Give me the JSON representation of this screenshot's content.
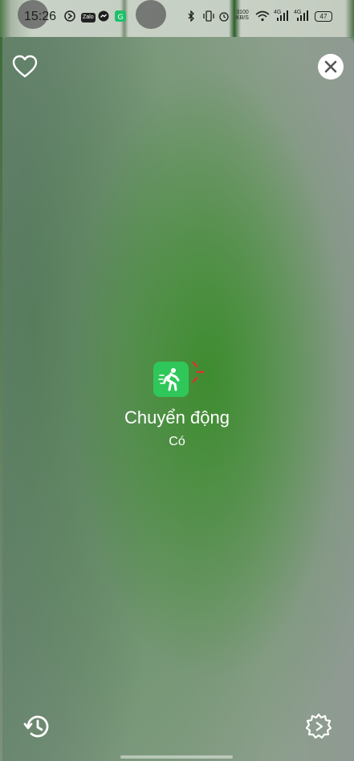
{
  "status_bar": {
    "time": "15:26",
    "notification_icons": [
      "pie-chart-icon",
      "zalo-icon",
      "messenger-icon",
      "app-green-icon"
    ],
    "zalo_label": "Zalo",
    "system_icons": [
      "bluetooth-icon",
      "vibrate-icon",
      "alarm-icon",
      "network-speed-icon",
      "wifi-icon",
      "signal-4g-icon",
      "signal-4g-icon"
    ],
    "network_speed": "3100 KB/S",
    "network_type_1": "4G",
    "network_type_2": "4G",
    "battery_level": "47"
  },
  "header": {
    "favorite_icon": "heart-outline-icon",
    "close_icon": "close-icon"
  },
  "device": {
    "icon": "walking-person-icon",
    "name": "Chuyển động",
    "state": "Có",
    "accent_color": "#2fc759",
    "alert_color": "#e0322b"
  },
  "footer": {
    "history_icon": "history-icon",
    "settings_icon": "gear-icon"
  }
}
